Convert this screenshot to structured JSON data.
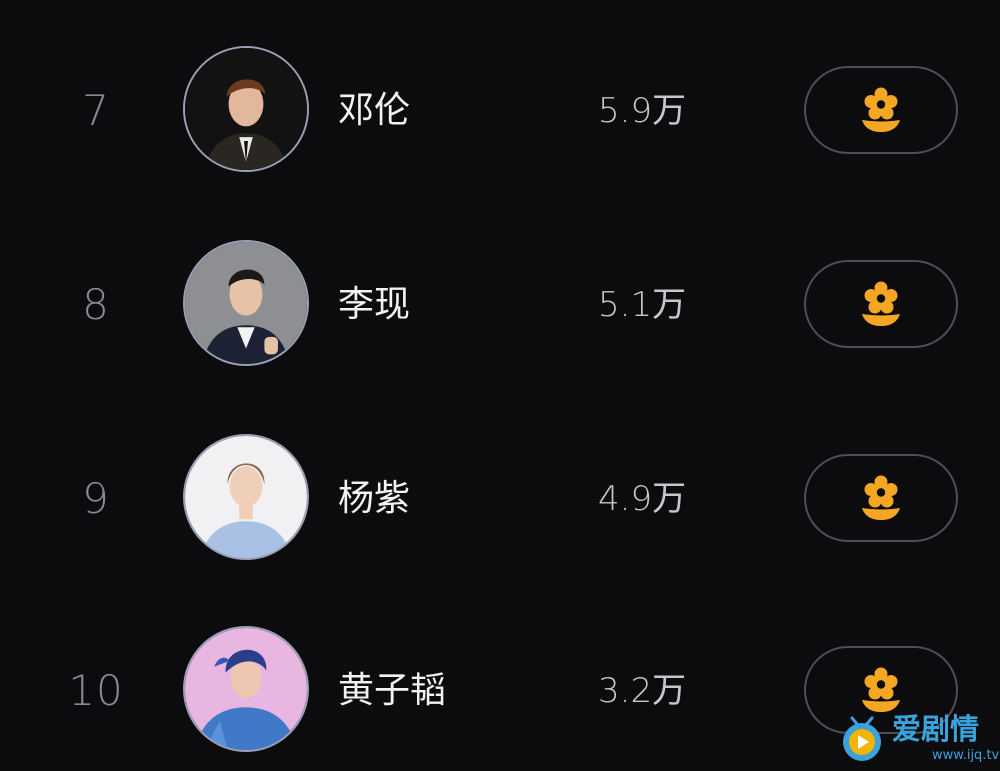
{
  "ranking": [
    {
      "rank": "7",
      "name": "邓伦",
      "score": "5.9万",
      "avatar_bg": "#121212",
      "avatar_icon": "avatar-photo-dark"
    },
    {
      "rank": "8",
      "name": "李现",
      "score": "5.1万",
      "avatar_bg": "#8e8f93",
      "avatar_icon": "avatar-photo-grey"
    },
    {
      "rank": "9",
      "name": "杨紫",
      "score": "4.9万",
      "avatar_bg": "#f1f1f3",
      "avatar_icon": "avatar-photo-light"
    },
    {
      "rank": "10",
      "name": "黄子韬",
      "score": "3.2万",
      "avatar_bg": "#e8b6e0",
      "avatar_icon": "avatar-photo-pink"
    }
  ],
  "action": {
    "icon": "flower-icon",
    "color": "#f5a623"
  },
  "watermark": {
    "title": "爱剧情",
    "url": "www.ijq.tv"
  }
}
